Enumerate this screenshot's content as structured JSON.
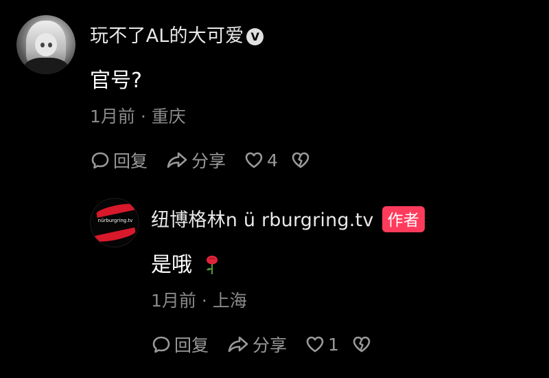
{
  "comment": {
    "username": "玩不了AL的大可爱",
    "verified_mark": "V",
    "text": "官号?",
    "time": "1月前",
    "separator": "·",
    "location": "重庆",
    "actions": {
      "reply_label": "回复",
      "share_label": "分享",
      "like_count": "4"
    }
  },
  "reply": {
    "username": "纽博格林n ü rburgring.tv",
    "author_badge": "作者",
    "avatar_logo_text": "nürburgring.tv",
    "text": "是哦",
    "time": "1月前",
    "separator": "·",
    "location": "上海",
    "actions": {
      "reply_label": "回复",
      "share_label": "分享",
      "like_count": "1"
    }
  },
  "icons": {
    "reply": "comment-bubble-icon",
    "share": "share-arrow-icon",
    "like": "heart-outline-icon",
    "dislike": "broken-heart-icon",
    "rose": "rose-emoji-icon",
    "verified": "verified-badge-icon"
  },
  "colors": {
    "background": "#000000",
    "author_badge": "#ff3b5c",
    "meta_text": "#8a8a8a",
    "logo_red": "#d7192b"
  }
}
